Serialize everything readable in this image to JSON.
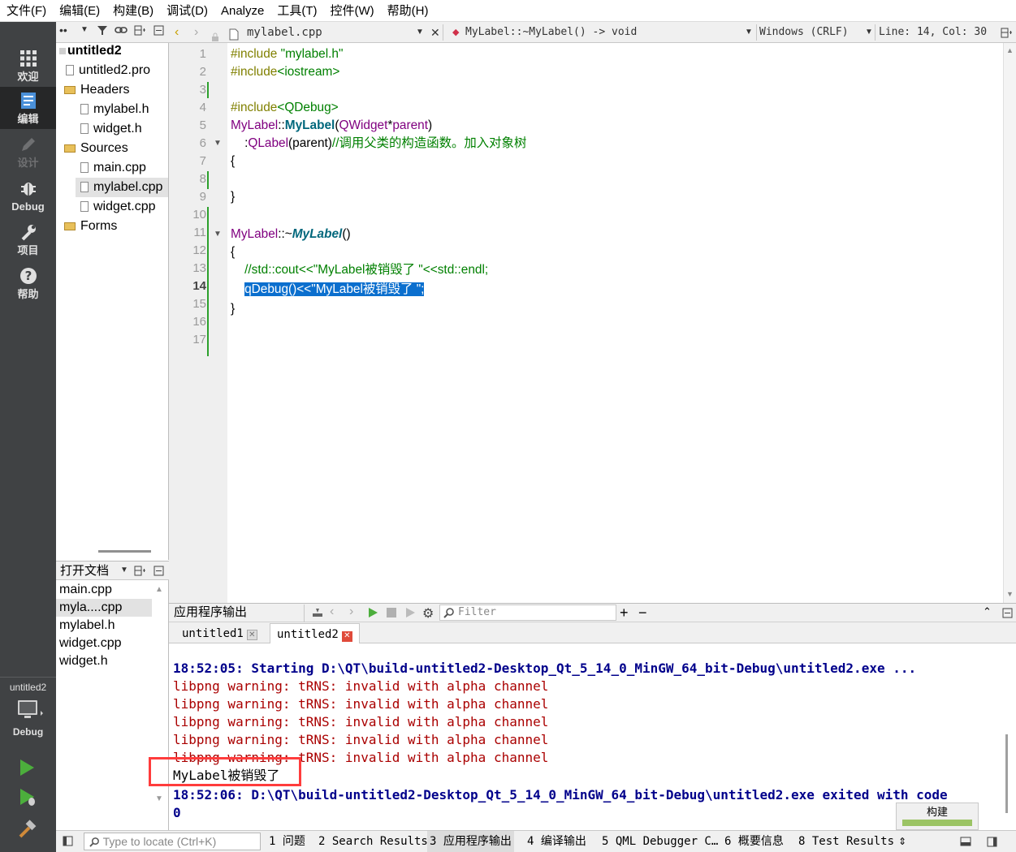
{
  "menubar": {
    "items": [
      "文件(F)",
      "编辑(E)",
      "构建(B)",
      "调试(D)",
      "Analyze",
      "工具(T)",
      "控件(W)",
      "帮助(H)"
    ]
  },
  "modes": [
    {
      "label": "欢迎",
      "icon": "grid-icon"
    },
    {
      "label": "编辑",
      "icon": "document-icon"
    },
    {
      "label": "设计",
      "icon": "pencil-icon"
    },
    {
      "label": "Debug",
      "icon": "bug-icon"
    },
    {
      "label": "项目",
      "icon": "wrench-icon"
    },
    {
      "label": "帮助",
      "icon": "help-icon"
    }
  ],
  "kit": {
    "project": "untitled2",
    "label": "Debug"
  },
  "project_tree": {
    "root": "untitled2",
    "pro_file": "untitled2.pro",
    "headers_label": "Headers",
    "headers": [
      "mylabel.h",
      "widget.h"
    ],
    "sources_label": "Sources",
    "sources": [
      "main.cpp",
      "mylabel.cpp",
      "widget.cpp"
    ],
    "forms_label": "Forms"
  },
  "open_documents": {
    "title": "打开文档",
    "items": [
      "main.cpp",
      "myla....cpp",
      "mylabel.h",
      "widget.cpp",
      "widget.h"
    ]
  },
  "editor_toolbar": {
    "file": "mylabel.cpp",
    "symbol": "MyLabel::~MyLabel() -> void",
    "line_endings": "Windows (CRLF)",
    "position": "Line: 14, Col: 30"
  },
  "editor": {
    "current_line": 14,
    "line_numbers": [
      "1",
      "2",
      "3",
      "4",
      "5",
      "6",
      "7",
      "8",
      "9",
      "10",
      "11",
      "12",
      "13",
      "14",
      "15",
      "16",
      "17"
    ]
  },
  "output": {
    "panel_title": "应用程序输出",
    "filter_placeholder": "Filter",
    "tabs": [
      "untitled1",
      "untitled2"
    ],
    "lines": [
      "18:52:05: Starting D:\\QT\\build-untitled2-Desktop_Qt_5_14_0_MinGW_64_bit-Debug\\untitled2.exe ...",
      "libpng warning: tRNS: invalid with alpha channel",
      "libpng warning: tRNS: invalid with alpha channel",
      "libpng warning: tRNS: invalid with alpha channel",
      "libpng warning: tRNS: invalid with alpha channel",
      "libpng warning: tRNS: invalid with alpha channel",
      "MyLabel被销毁了",
      "18:52:06: D:\\QT\\build-untitled2-Desktop_Qt_5_14_0_MinGW_64_bit-Debug\\untitled2.exe exited with code",
      "0"
    ]
  },
  "statusbar": {
    "locate_placeholder": "Type to locate (Ctrl+K)",
    "panes": [
      "1 问题",
      "2 Search Results",
      "3 应用程序输出",
      "4 编译输出",
      "5 QML Debugger C…",
      "6 概要信息",
      "8 Test Results"
    ]
  },
  "build_progress": {
    "label": "构建",
    "progress": 1.0
  },
  "colors": {
    "sidebar_bg": "#404244",
    "selection": "#0b6fce",
    "highlight_box": "#ff3c3c",
    "output_blue": "#00008b",
    "output_red": "#aa0000"
  }
}
